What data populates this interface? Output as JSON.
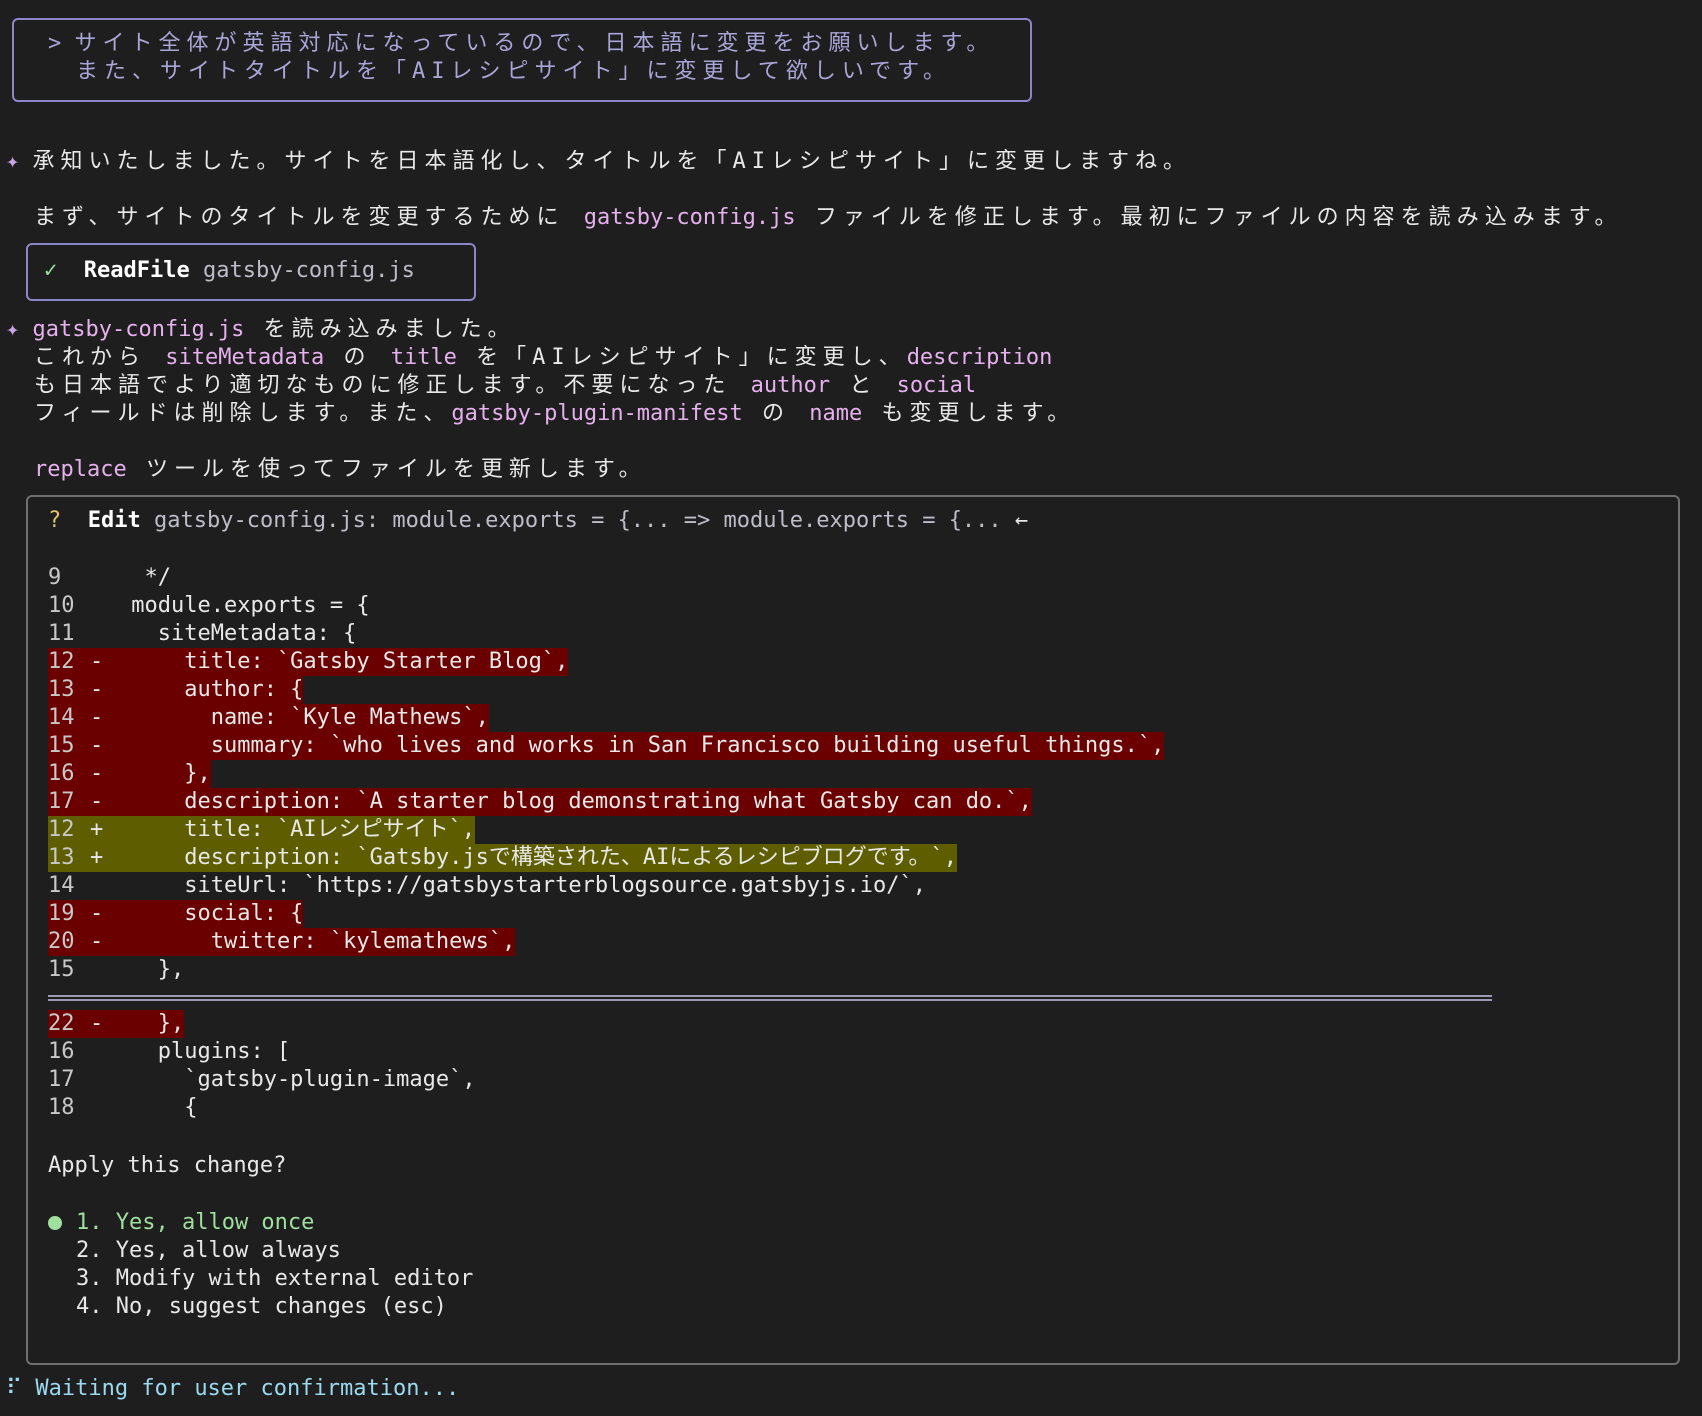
{
  "prompt": {
    "prefix": ">",
    "line1": "サイト全体が英語対応になっているので、日本語に変更をお願いします。",
    "line2": "また、サイトタイトルを「AIレシピサイト」に変更して欲しいです。"
  },
  "response1": {
    "text": "承知いたしました。サイトを日本語化し、タイトルを「AIレシピサイト」に変更しますね。"
  },
  "response2": {
    "part1": "まず、サイトのタイトルを変更するために ",
    "filename": "gatsby-config.js",
    "part2": " ファイルを修正します。最初にファイルの内容を読み込みます。"
  },
  "readfile": {
    "check": "✓",
    "tool": "ReadFile",
    "arg": "gatsby-config.js"
  },
  "response3": {
    "l1_file": "gatsby-config.js",
    "l1_text": " を読み込みました。",
    "l2_a": "これから ",
    "l2_b": "siteMetadata",
    "l2_c": " の ",
    "l2_d": "title",
    "l2_e": " を「AIレシピサイト」に変更し、",
    "l2_f": "description",
    "l3_a": "も日本語でより適切なものに修正します。不要になった ",
    "l3_b": "author",
    "l3_c": " と ",
    "l3_d": "social",
    "l4_a": "フィールドは削除します。また、",
    "l4_b": "gatsby-plugin-manifest",
    "l4_c": " の ",
    "l4_d": "name",
    "l4_e": " も変更します。",
    "l5_a": "replace",
    "l5_b": " ツールを使ってファイルを更新します。"
  },
  "edit": {
    "q": "?",
    "tool": "Edit",
    "summary": "gatsby-config.js: module.exports = {... => module.exports = {...",
    "arrow": "←",
    "diff_top": [
      {
        "n": "9",
        "s": "",
        "code": "  */",
        "type": "ctx"
      },
      {
        "n": "10",
        "s": "",
        "code": " module.exports = {",
        "type": "ctx"
      },
      {
        "n": "11",
        "s": "",
        "code": "   siteMetadata: {",
        "type": "ctx"
      },
      {
        "n": "12",
        "s": "-",
        "code": "     title: `Gatsby Starter Blog`,",
        "type": "del"
      },
      {
        "n": "13",
        "s": "-",
        "code": "     author: {",
        "type": "del"
      },
      {
        "n": "14",
        "s": "-",
        "code": "       name: `Kyle Mathews`,",
        "type": "del"
      },
      {
        "n": "15",
        "s": "-",
        "code": "       summary: `who lives and works in San Francisco building useful things.`,",
        "type": "del"
      },
      {
        "n": "16",
        "s": "-",
        "code": "     },",
        "type": "del"
      },
      {
        "n": "17",
        "s": "-",
        "code": "     description: `A starter blog demonstrating what Gatsby can do.`,",
        "type": "del"
      },
      {
        "n": "12",
        "s": "+",
        "code": "     title: `AIレシピサイト`,",
        "type": "add"
      },
      {
        "n": "13",
        "s": "+",
        "code": "     description: `Gatsby.jsで構築された、AIによるレシピブログです。`,",
        "type": "add"
      },
      {
        "n": "14",
        "s": "",
        "code": "     siteUrl: `https://gatsbystarterblogsource.gatsbyjs.io/`,",
        "type": "ctx"
      },
      {
        "n": "19",
        "s": "-",
        "code": "     social: {",
        "type": "del"
      },
      {
        "n": "20",
        "s": "-",
        "code": "       twitter: `kylemathews`,",
        "type": "del"
      },
      {
        "n": "15",
        "s": "",
        "code": "   },",
        "type": "ctx"
      }
    ],
    "diff_bottom": [
      {
        "n": "22",
        "s": "-",
        "code": "   },",
        "type": "del"
      },
      {
        "n": "16",
        "s": "",
        "code": "   plugins: [",
        "type": "ctx"
      },
      {
        "n": "17",
        "s": "",
        "code": "     `gatsby-plugin-image`,",
        "type": "ctx"
      },
      {
        "n": "18",
        "s": "",
        "code": "     {",
        "type": "ctx"
      }
    ],
    "question": "Apply this change?",
    "options": [
      "1. Yes, allow once",
      "2. Yes, allow always",
      "3. Modify with external editor",
      "4. No, suggest changes (esc)"
    ],
    "selected_option": "1. Yes, allow once"
  },
  "status": {
    "spinner": "⠏",
    "text": "Waiting for user confirmation..."
  },
  "colors": {
    "background": "#1e1e1e",
    "deleted_line": "#6b0000",
    "added_line": "#5e5e00",
    "prompt_border": "#8c86c8",
    "accent_pink": "#e6b0ee",
    "accent_cyan": "#9ad9f0",
    "selected_green": "#9fe09f"
  }
}
